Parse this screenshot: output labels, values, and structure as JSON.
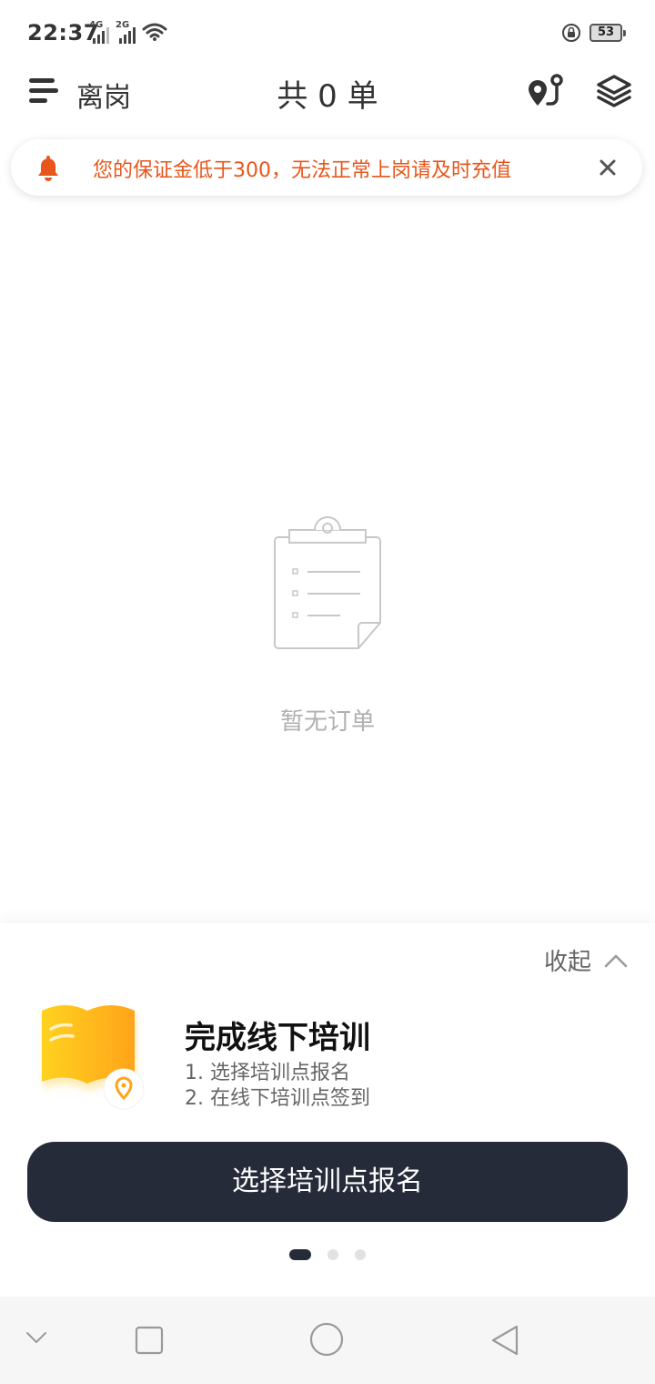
{
  "status_bar": {
    "time": "22:37",
    "network_1": "4G",
    "network_2": "2G",
    "battery": "53"
  },
  "header": {
    "status_label": "离岗",
    "order_count": "共 0 单"
  },
  "notice": {
    "text": "您的保证金低于300，无法正常上岗请及时充值",
    "color": "#e8561c"
  },
  "empty_state": {
    "text": "暂无订单"
  },
  "panel": {
    "collapse_label": "收起",
    "card": {
      "title": "完成线下培训",
      "step_1": "1. 选择培训点报名",
      "step_2": "2. 在线下培训点签到"
    },
    "button_label": "选择培训点报名",
    "pagination": {
      "total": 3,
      "active_index": 0
    }
  },
  "colors": {
    "accent_dark": "#262b3a",
    "warning": "#e8561c",
    "book_orange": "#ffa41a"
  },
  "icons": [
    "menu-icon",
    "route-icon",
    "layers-icon",
    "bell-icon",
    "close-icon",
    "clipboard-icon",
    "chevron-up-icon",
    "book-location-icon",
    "nav-back-icon",
    "nav-home-icon",
    "nav-recents-icon",
    "nav-collapse-icon"
  ]
}
